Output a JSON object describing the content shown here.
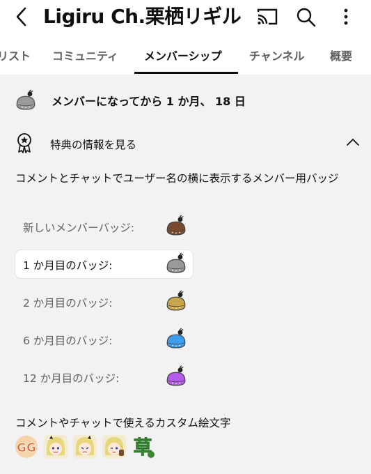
{
  "header": {
    "title": "Ligiru Ch.栗栖リギル"
  },
  "tabs": [
    {
      "label": "リスト"
    },
    {
      "label": "コミュニティ"
    },
    {
      "label": "メンバーシップ"
    },
    {
      "label": "チャンネル"
    },
    {
      "label": "概要"
    }
  ],
  "membership": {
    "status": "メンバーになってから 1 か月、 18 日",
    "perks_label": "特典の情報を見る",
    "badge_section_title": "コメントとチャットでユーザー名の横に表示するメンバー用バッジ",
    "badges": [
      {
        "label": "新しいメンバーバッジ:",
        "color": "#7a4a2e"
      },
      {
        "label": "1 か月目のバッジ:",
        "color": "#9a9a9a"
      },
      {
        "label": "2 か月目のバッジ:",
        "color": "#c9a64a"
      },
      {
        "label": "6 か月目のバッジ:",
        "color": "#3b9ef0"
      },
      {
        "label": "12 か月目のバッジ:",
        "color": "#b55de8"
      }
    ],
    "emoji_section_title": "コメントやチャットで使えるカスタム絵文字",
    "emoji_gg_text": "GG",
    "emoji_kusa_text": "草"
  },
  "colors": {
    "panel_bg": "#f2f2f2",
    "accent_text": "#0f0f0f",
    "muted_text": "#606060"
  }
}
